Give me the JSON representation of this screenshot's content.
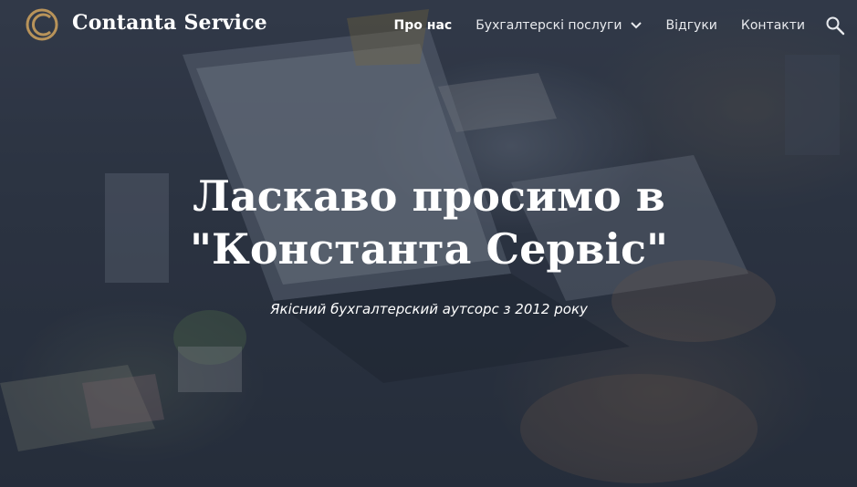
{
  "header": {
    "site_title": "Contanta Service",
    "logo_icon": "ring-logo-icon",
    "nav": {
      "items": [
        {
          "label": "Про нас",
          "active": true
        },
        {
          "label": "Бухгалтерскі послуги",
          "active": false,
          "has_dropdown": true
        },
        {
          "label": "Відгуки",
          "active": false
        },
        {
          "label": "Контакти",
          "active": false
        }
      ]
    },
    "search_icon": "search-icon"
  },
  "hero": {
    "title": "Ласкаво просимо в \"Константа Сервіс\"",
    "subtitle": "Якісний бухгалтерский аутсорс з 2012 року"
  },
  "colors": {
    "text": "#ffffff",
    "logo_ring": "#b8935a",
    "overlay": "#141c2d"
  }
}
